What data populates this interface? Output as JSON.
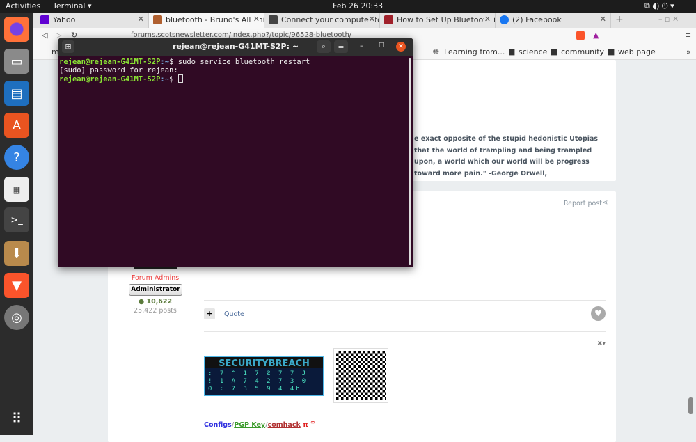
{
  "topbar": {
    "activities": "Activities",
    "app": "Terminal ▾",
    "clock": "Feb 26  20:33",
    "tray": "⧉ ◖) ⏻ ▾"
  },
  "tabs": [
    {
      "label": "Yahoo",
      "color": "#6001d2"
    },
    {
      "label": "bluetooth - Bruno's All Thi",
      "color": "#b06030"
    },
    {
      "label": "Connect your computer to",
      "color": "#444444"
    },
    {
      "label": "How to Set Up Bluetooth i",
      "color": "#a0202a"
    },
    {
      "label": "(2) Facebook",
      "color": "#1877f2"
    }
  ],
  "browser": {
    "url": "forums.scotsnewsletter.com/index.php?/topic/96528-bluetooth/",
    "new_tab": "+"
  },
  "bookmarks": [
    "m",
    "Learning from...",
    "science",
    "community",
    "web page"
  ],
  "terminal": {
    "title": "rejean@rejean-G41MT-S2P: ~",
    "lines": [
      {
        "user": "rejean@rejean-G41MT-S2P",
        "path": ":~",
        "cmd": "$ sudo service bluetooth restart"
      },
      {
        "text": "[sudo] password for rejean:"
      },
      {
        "user": "rejean@rejean-G41MT-S2P",
        "path": ":~",
        "cmd": "$ "
      }
    ]
  },
  "post": {
    "quote": "e exact opposite of the stupid hedonistic Utopias that the world of trampling and being trampled upon, a world which our world will be progress toward more pain.\" -George Orwell,",
    "report": "Report post",
    "group": "Forum Admins",
    "rank": "Administrator",
    "reputation": "10,622",
    "posts": "25,422 posts",
    "quote_btn": "Quote",
    "banner": "SECURITYBREACH",
    "sig": {
      "configs": "Configs",
      "pgp": "PGP Key",
      "comhack": "comhack",
      "pi": "π",
      "inf": "∞"
    }
  }
}
